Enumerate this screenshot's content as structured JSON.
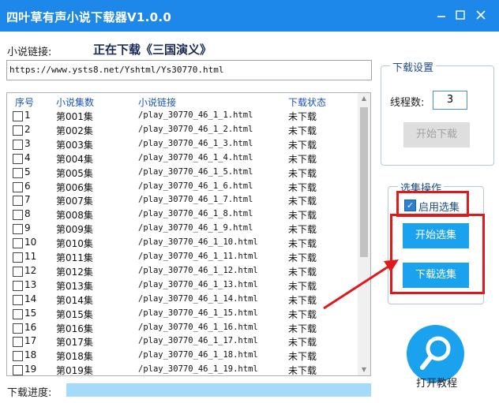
{
  "window": {
    "title": "四叶草有声小说下载器V1.0.0",
    "controls": [
      "minimize",
      "restore",
      "close"
    ]
  },
  "url_label": "小说链接:",
  "download_status": "正在下载《三国演义》",
  "url_value": "https://www.ysts8.net/Yshtml/Ys30770.html",
  "table": {
    "columns": [
      "序号",
      "小说集数",
      "小说链接",
      "下载状态"
    ],
    "rows": [
      {
        "no": "1",
        "name": "第001集",
        "link": "/play_30770_46_1_1.html",
        "status": "未下载"
      },
      {
        "no": "2",
        "name": "第002集",
        "link": "/play_30770_46_1_2.html",
        "status": "未下载"
      },
      {
        "no": "3",
        "name": "第003集",
        "link": "/play_30770_46_1_3.html",
        "status": "未下载"
      },
      {
        "no": "4",
        "name": "第004集",
        "link": "/play_30770_46_1_4.html",
        "status": "未下载"
      },
      {
        "no": "5",
        "name": "第005集",
        "link": "/play_30770_46_1_5.html",
        "status": "未下载"
      },
      {
        "no": "6",
        "name": "第006集",
        "link": "/play_30770_46_1_6.html",
        "status": "未下载"
      },
      {
        "no": "7",
        "name": "第007集",
        "link": "/play_30770_46_1_7.html",
        "status": "未下载"
      },
      {
        "no": "8",
        "name": "第008集",
        "link": "/play_30770_46_1_8.html",
        "status": "未下载"
      },
      {
        "no": "9",
        "name": "第009集",
        "link": "/play_30770_46_1_9.html",
        "status": "未下载"
      },
      {
        "no": "10",
        "name": "第010集",
        "link": "/play_30770_46_1_10.html",
        "status": "未下载"
      },
      {
        "no": "11",
        "name": "第011集",
        "link": "/play_30770_46_1_11.html",
        "status": "未下载"
      },
      {
        "no": "12",
        "name": "第012集",
        "link": "/play_30770_46_1_12.html",
        "status": "未下载"
      },
      {
        "no": "13",
        "name": "第013集",
        "link": "/play_30770_46_1_13.html",
        "status": "未下载"
      },
      {
        "no": "14",
        "name": "第014集",
        "link": "/play_30770_46_1_14.html",
        "status": "未下载"
      },
      {
        "no": "15",
        "name": "第015集",
        "link": "/play_30770_46_1_15.html",
        "status": "未下载"
      },
      {
        "no": "16",
        "name": "第016集",
        "link": "/play_30770_46_1_16.html",
        "status": "未下载"
      },
      {
        "no": "17",
        "name": "第017集",
        "link": "/play_30770_46_1_17.html",
        "status": "未下载"
      },
      {
        "no": "18",
        "name": "第018集",
        "link": "/play_30770_46_1_18.html",
        "status": "未下载"
      },
      {
        "no": "19",
        "name": "第019集",
        "link": "/play_30770_46_1_19.html",
        "status": "未下载"
      }
    ]
  },
  "settings": {
    "group_title": "下载设置",
    "thread_label": "线程数:",
    "thread_value": "3",
    "start_download": "开始下载"
  },
  "selection": {
    "group_title": "选集操作",
    "enable_label": "启用选集",
    "enabled": true,
    "start_select": "开始选集",
    "download_select": "下载选集"
  },
  "help_label": "打开教程",
  "progress_label": "下载进度:",
  "colors": {
    "titlebar": "#1e88ea",
    "accent_button": "#1aa2ef",
    "highlight": "#e0191a"
  }
}
